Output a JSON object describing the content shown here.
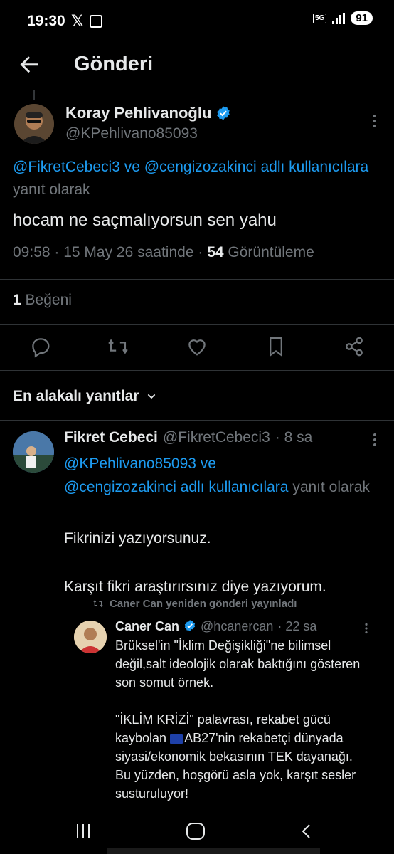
{
  "status_bar": {
    "time": "19:30",
    "x_glyph": "𝕏",
    "network": "5G",
    "battery": "91"
  },
  "header": {
    "title": "Gönderi"
  },
  "main_post": {
    "author_name": "Koray Pehlivanoğlu",
    "author_handle": "@KPehlivano85093",
    "verified": true,
    "reply_mention_1": "@FikretCebeci3",
    "reply_and": " ve ",
    "reply_mention_2": "@cengizozakinci",
    "reply_suffix_link": " adlı kullanıcılara",
    "reply_suffix": " yanıt olarak",
    "text": "hocam ne saçmalıyorsun sen yahu",
    "time": "09:58",
    "date_text": " · 15 May 26 saatinde · ",
    "views_count": "54",
    "views_label": " Görüntüleme",
    "likes_count": "1",
    "likes_label": " Beğeni"
  },
  "actions": {
    "icons": [
      "reply-icon",
      "retweet-icon",
      "like-icon",
      "bookmark-icon",
      "share-icon"
    ]
  },
  "sort": {
    "label": "En alakalı yanıtlar"
  },
  "reply": {
    "author_name": "Fikret Cebeci",
    "author_handle": "@FikretCebeci3",
    "time_ago": "· 8 sa",
    "mention_1": "@KPehlivano85093",
    "and": " ve ",
    "mention_2": "@cengizozakinci",
    "suffix_link": " adlı kullanıcılara",
    "suffix": " yanıt olarak",
    "text": "Fikrinizi yazıyorsunuz.\n\nKarşıt fikri araştırırsınız diye yazıyorum."
  },
  "quote": {
    "retweet_label": "Caner Can yeniden gönderi yayınladı",
    "author_name": "Caner Can",
    "author_handle": "@hcanercan",
    "time_ago": "· 22 sa",
    "verified": true,
    "text_1": "Brüksel'in \"İklim Değişikliği\"ne bilimsel değil,salt ideolojik olarak baktığını gösteren son somut örnek.\n\n\"İKLİM KRİZİ\" palavrası, rekabet gücü kaybolan ",
    "text_2": "AB27'nin rekabetçi dünyada siyasi/ekonomik bekasının TEK dayanağı. Bu yüzden, hoşgörü asla yok, karşıt sesler susturuluyor!"
  },
  "colors": {
    "background": "#000000",
    "link": "#1d9bf0",
    "muted": "#71767b",
    "text": "#e7e9ea",
    "verified": "#1d9bf0"
  }
}
